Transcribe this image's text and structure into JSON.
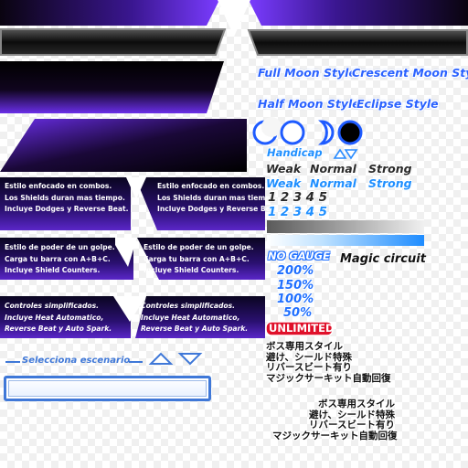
{
  "style_names": {
    "full_moon": "Full Moon Style",
    "crescent_moon": "Crescent Moon Style",
    "half_moon": "Half Moon Style",
    "eclipse": "Eclipse  Style"
  },
  "style_descriptions": {
    "left": [
      [
        "Estilo enfocado en combos.",
        "Los Shields duran mas tiempo.",
        "Incluye Dodges y Reverse Beat."
      ],
      [
        "Estilo de poder de un golpe.",
        "Carga tu barra con A+B+C.",
        "Incluye Shield Counters."
      ],
      [
        "Controles simplificados.",
        "Incluye Heat Automatico,",
        "Reverse Beat y Auto Spark."
      ]
    ],
    "right": [
      [
        "Estilo enfocado en combos.",
        "Los Shields duran mas tiempo.",
        "Incluye Dodges y Reverse Beat."
      ],
      [
        "Estilo de poder de un golpe.",
        "Carga tu barra con A+B+C.",
        "Incluye Shield Counters."
      ],
      [
        "Controles simplificados.",
        "Incluye Heat Automatico,",
        "Reverse Beat y Auto Spark."
      ]
    ]
  },
  "handicap": {
    "label": "Handicap",
    "levels_dark": [
      "Weak",
      "Normal",
      "Strong"
    ],
    "levels_blue": [
      "Weak",
      "Normal",
      "Strong"
    ],
    "digits_dark": "12345",
    "digits_blue": "12345"
  },
  "gauge": {
    "no_gauge": "NO GAUGE",
    "magic_circuit": "Magic circuit",
    "options": [
      "200%",
      "150%",
      "100%",
      "50%"
    ],
    "unlimited": "UNLIMITED"
  },
  "boss_lines_left": [
    "ボス専用スタイル",
    "避け、シールド特殊",
    "リバースビート有り",
    "マジックサーキット自動回復"
  ],
  "boss_lines_right": [
    "ボス専用スタイル",
    "避け、シールド特殊",
    "リバースビート有り",
    "マジックサーキット自動回復"
  ],
  "stage_select": {
    "label": "Selecciona escenario",
    "input_value": ""
  },
  "colors": {
    "purple": "#5a1fd0",
    "blue_text": "#2b62ff",
    "red_pill": "#e0102a",
    "selector_blue": "#3f78d8"
  },
  "icons": [
    "crescent-moon-icon",
    "full-moon-icon",
    "half-moon-icon",
    "eclipse-icon",
    "arrow-up-icon",
    "arrow-down-icon"
  ]
}
